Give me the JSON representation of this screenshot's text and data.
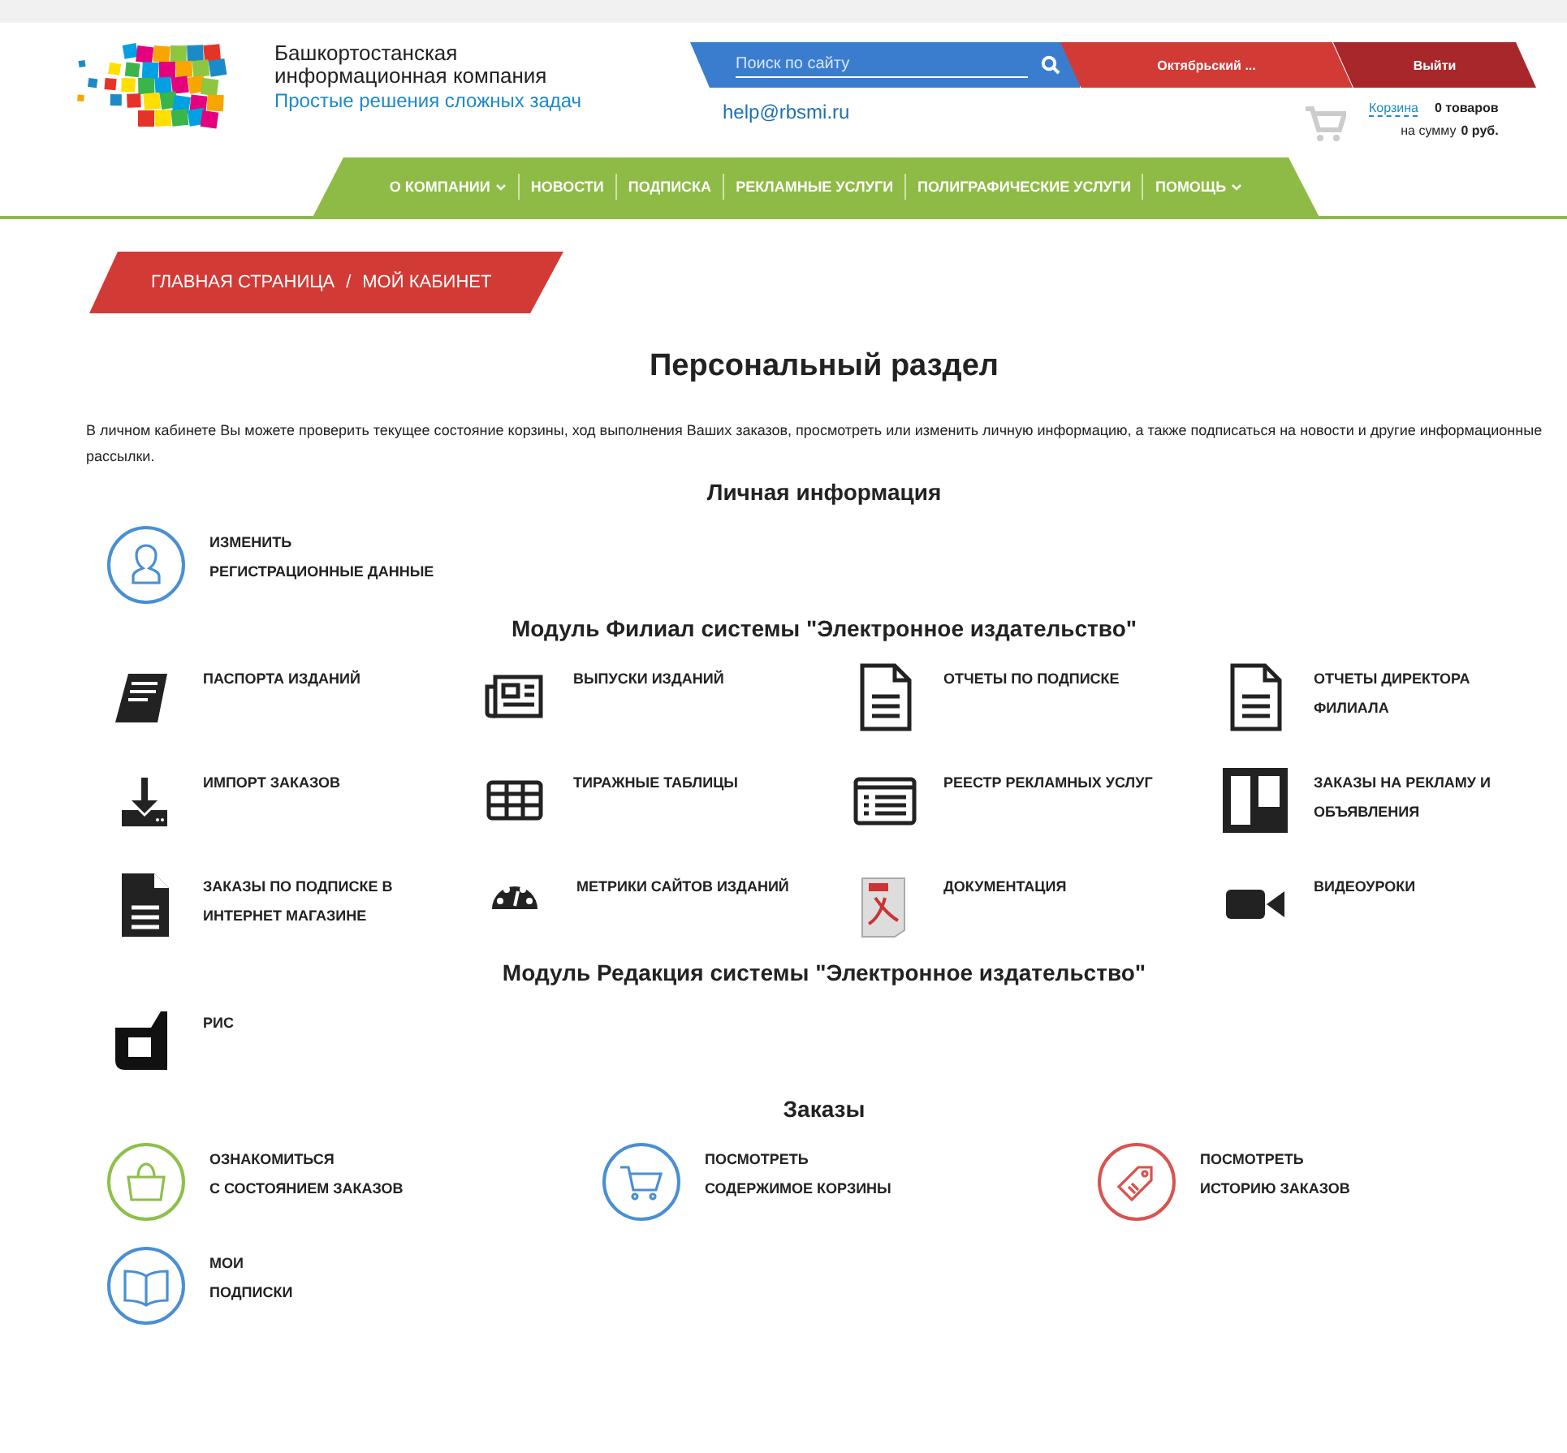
{
  "header": {
    "company_name": [
      "Башкортостанская",
      "информационная компания"
    ],
    "slogan": "Простые решения сложных задач",
    "search": {
      "placeholder": "Поиск по сайту"
    },
    "user_button": "Октябрьский ...",
    "logout_button": "Выйти",
    "email": "help@rbsmi.ru",
    "cart": {
      "link": "Корзина",
      "count": "0 товаров",
      "sum_label": "на сумму",
      "sum": "0 руб."
    }
  },
  "nav": [
    {
      "label": "О КОМПАНИИ",
      "dropdown": true
    },
    {
      "label": "НОВОСТИ",
      "dropdown": false
    },
    {
      "label": "ПОДПИСКА",
      "dropdown": false
    },
    {
      "label": "РЕКЛАМНЫЕ УСЛУГИ",
      "dropdown": false
    },
    {
      "label": "ПОЛИГРАФИЧЕСКИЕ УСЛУГИ",
      "dropdown": false
    },
    {
      "label": "ПОМОЩЬ",
      "dropdown": true
    }
  ],
  "breadcrumb": [
    "ГЛАВНАЯ СТРАНИЦА",
    "МОЙ КАБИНЕТ"
  ],
  "breadcrumb_separator": "/",
  "title": "Персональный раздел",
  "intro": "В личном кабинете Вы можете проверить текущее состояние корзины, ход выполнения Ваших заказов, просмотреть или изменить личную информацию, а также подписаться на новости и другие информационные рассылки.",
  "sections": [
    {
      "title": "Личная информация",
      "kind": "icons",
      "items": [
        {
          "kind": "user",
          "color": "#4a8fd4",
          "lines": [
            "ИЗМЕНИТЬ",
            "РЕГИСТРАЦИОННЫЕ ДАННЫЕ"
          ]
        }
      ]
    },
    {
      "title": "Модуль Филиал системы \"Электронное издательство\"",
      "kind": "icons",
      "items": [
        {
          "kind": "book",
          "lines": [
            "ПАСПОРТА ИЗДАНИЙ"
          ]
        },
        {
          "kind": "newspaper",
          "lines": [
            "ВЫПУСКИ ИЗДАНИЙ"
          ]
        },
        {
          "kind": "document",
          "lines": [
            "ОТЧЕТЫ ПО ПОДПИСКЕ"
          ]
        },
        {
          "kind": "document",
          "lines": [
            "ОТЧЕТЫ ДИРЕКТОРА",
            "ФИЛИАЛА"
          ]
        },
        {
          "kind": "download",
          "lines": [
            "ИМПОРТ ЗАКАЗОВ"
          ]
        },
        {
          "kind": "table",
          "lines": [
            "ТИРАЖНЫЕ ТАБЛИЦЫ"
          ]
        },
        {
          "kind": "list",
          "lines": [
            "РЕЕСТР РЕКЛАМНЫХ УСЛУГ"
          ]
        },
        {
          "kind": "columns",
          "lines": [
            "ЗАКАЗЫ НА РЕКЛАМУ И",
            "ОБЪЯВЛЕНИЯ"
          ]
        },
        {
          "kind": "filled-document",
          "lines": [
            "ЗАКАЗЫ ПО ПОДПИСКЕ В",
            "ИНТЕРНЕТ МАГАЗИНЕ"
          ]
        },
        {
          "kind": "gauge",
          "lines": [
            "МЕТРИКИ САЙТОВ ИЗДАНИЙ"
          ]
        },
        {
          "kind": "pdf",
          "lines": [
            "ДОКУМЕНТАЦИЯ"
          ]
        },
        {
          "kind": "video",
          "lines": [
            "ВИДЕОУРОКИ"
          ]
        }
      ]
    },
    {
      "title": "Модуль Редакция системы \"Электронное издательство\"",
      "kind": "icons",
      "items": [
        {
          "kind": "logo",
          "lines": [
            "РИС"
          ]
        }
      ]
    },
    {
      "title": "Заказы",
      "kind": "rings",
      "items": [
        {
          "kind": "bag",
          "color": "#8dc04a",
          "lines": [
            "ОЗНАКОМИТЬСЯ",
            "С СОСТОЯНИЕМ ЗАКАЗОВ"
          ]
        },
        {
          "kind": "cart",
          "color": "#4a8fd4",
          "lines": [
            "ПОСМОТРЕТЬ",
            "СОДЕРЖИМОЕ КОРЗИНЫ"
          ]
        },
        {
          "kind": "tag",
          "color": "#d9534f",
          "lines": [
            "ПОСМОТРЕТЬ",
            "ИСТОРИЮ ЗАКАЗОВ"
          ]
        },
        {
          "kind": "open-book",
          "color": "#4a8fd4",
          "lines": [
            "МОИ",
            "ПОДПИСКИ"
          ]
        }
      ]
    }
  ]
}
